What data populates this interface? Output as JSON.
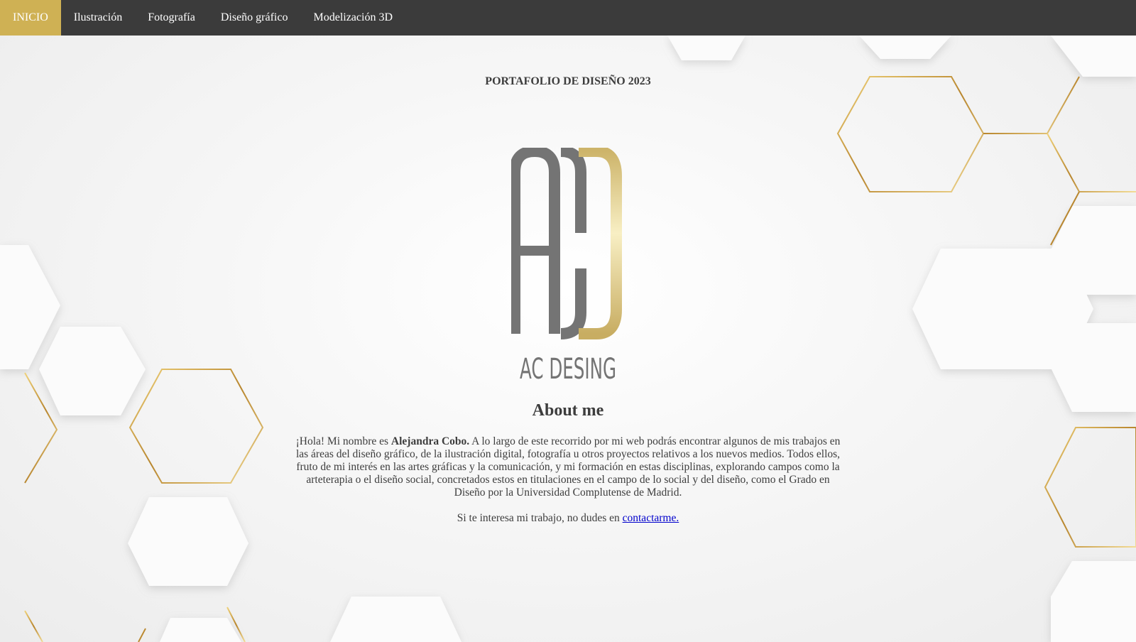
{
  "nav": {
    "items": [
      {
        "label": "INICIO",
        "active": true
      },
      {
        "label": "Ilustración",
        "active": false
      },
      {
        "label": "Fotografía",
        "active": false
      },
      {
        "label": "Diseño gráfico",
        "active": false
      },
      {
        "label": "Modelización 3D",
        "active": false
      }
    ]
  },
  "header": {
    "title": "PORTAFOLIO DE DISEÑO 2023"
  },
  "logo": {
    "monogram": "ACD",
    "wordmark": "AC DESING"
  },
  "about": {
    "heading": "About me",
    "intro": "¡Hola! Mi nombre es ",
    "name": "Alejandra Cobo.",
    "body": " A lo largo de este recorrido por mi web podrás encontrar algunos de mis trabajos en las áreas del diseño gráfico, de la ilustración digital, fotografía u otros proyectos relativos a los nuevos medios. Todos ellos, fruto de mi interés en las artes gráficas y la comunicación, y mi formación en estas disciplinas, explorando campos como la arteterapia o el diseño social, concretados estos en titulaciones en el campo de lo social y del diseño, como el Grado en Diseño por la Universidad Complutense de Madrid.",
    "contact_prefix": "Si te interesa mi trabajo, no dudes en ",
    "contact_link": "contactarme."
  },
  "colors": {
    "navbar": "#3b3b3b",
    "accent_gold": "#cfb154",
    "text": "#3d3d3d",
    "logo_grey": "#747474",
    "link": "#0000cc"
  }
}
